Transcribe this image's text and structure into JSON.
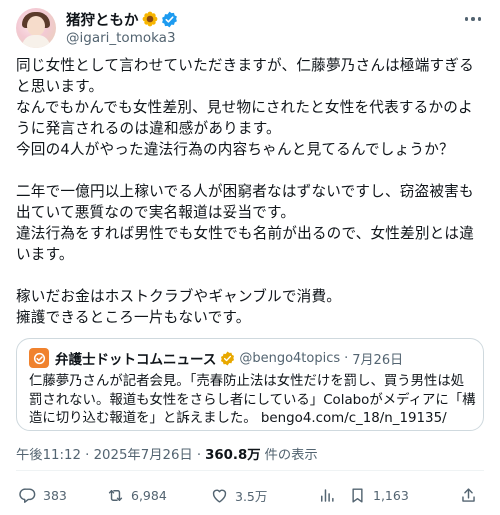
{
  "author": {
    "display_name": "猪狩ともか",
    "handle": "@igari_tomoka3"
  },
  "tweet": {
    "text": "同じ女性として言わせていただきますが、仁藤夢乃さんは極端すぎると思います。\nなんでもかんでも女性差別、見せ物にされたと女性を代表するかのように発言されるのは違和感があります。\n今回の4人がやった違法行為の内容ちゃんと見てるんでしょうか？\n\n二年で一億円以上稼いでる人が困窮者なはずないですし、窃盗被害も出ていて悪質なので実名報道は妥当です。\n違法行為をすれば男性でも女性でも名前が出るので、女性差別とは違います。\n\n稼いだお金はホストクラブやギャンブルで消費。\n擁護できるところ一片もないです。"
  },
  "quote": {
    "display_name": "弁護士ドットコムニュース",
    "handle": "@bengo4topics",
    "dot": "·",
    "date": "7月26日",
    "text": "仁藤夢乃さんが記者会見。「売春防止法は女性だけを罰し、買う男性は処罰されない。報道も女性をさらし者にしている」Colaboがメディアに「構造に切り込む報道を」と訴えました。 bengo4.com/c_18/n_19135/"
  },
  "meta": {
    "timestamp": "午後11:12 · 2025年7月26日 ·",
    "views_count": "360.8万",
    "views_label": "件の表示"
  },
  "actions": {
    "replies": "383",
    "reposts": "6,984",
    "likes": "3.5万",
    "bookmarks": "1,163"
  },
  "colors": {
    "verified": "#1d9bf0",
    "text_primary": "#0f1419",
    "text_secondary": "#536471",
    "border": "#cfd9de",
    "quote_logo": "#f0822e"
  },
  "icons": {
    "avatar": "profile-photo",
    "name_emoji": "sunflower",
    "badge": "verified-check",
    "more": "ellipsis",
    "reply": "speech-bubble",
    "repost": "repost-arrows",
    "like": "heart",
    "views": "bar-chart",
    "bookmark": "bookmark",
    "share": "share-arrow"
  }
}
